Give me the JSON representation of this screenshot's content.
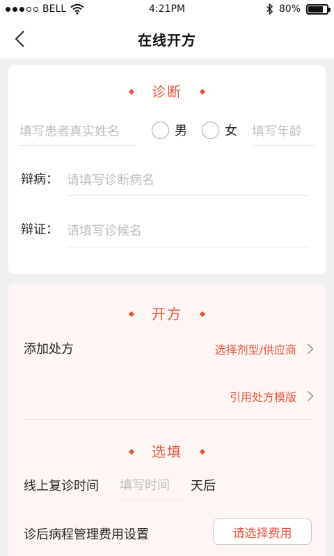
{
  "status_bar": {
    "carrier": "BELL",
    "time": "4:21PM",
    "battery": "80%",
    "battery_level": 0.8
  },
  "header": {
    "title": "在线开方"
  },
  "diagnosis": {
    "section_title": "诊断",
    "name_placeholder": "填写患者真实姓名",
    "gender_male": "男",
    "gender_female": "女",
    "age_placeholder": "填写年龄",
    "disease_label": "辩病：",
    "disease_placeholder": "请填写诊断病名",
    "syndrome_label": "辩证：",
    "syndrome_placeholder": "请填写诊候名"
  },
  "prescription": {
    "section_title": "开方",
    "add_label": "添加处方",
    "select_type_link": "选择剂型/供应商",
    "template_link": "引用处方模版"
  },
  "optional": {
    "section_title": "选填",
    "followup_label": "线上复诊时间",
    "followup_placeholder": "填写时间",
    "followup_suffix": "天后",
    "fee_label": "诊后病程管理费用设置",
    "fee_button": "请选择费用"
  }
}
